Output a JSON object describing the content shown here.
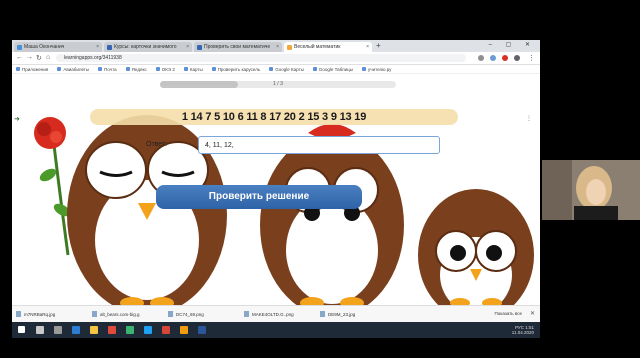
{
  "browser": {
    "tabs": [
      {
        "label": "Маша Окончанич",
        "color": "#4a90d9"
      },
      {
        "label": "Курсы: карточки значимого",
        "color": "#3466b4"
      },
      {
        "label": "Проверить свои математиче",
        "color": "#3466b4"
      },
      {
        "label": "Веселый математик",
        "color": "#f2a93b",
        "active": true
      }
    ],
    "new_tab": "+",
    "window_controls": "– ▢ ✕",
    "url": "learningapps.org/3411938",
    "bookmarks": [
      "Приложения",
      "Авиабилеты",
      "Почта",
      "Яндекс",
      "ОКЭ 2",
      "Карты",
      "Проверить карусель",
      "Google Карты",
      "Google Таблицы",
      "учителю.ру"
    ]
  },
  "task": {
    "progress_text": "1 / 3",
    "progress_fraction": 0.33,
    "numbers": "1 14 7 5 10 6 11 8 17 20 2 15 3 9 13 19",
    "answer_label": "Ответ:",
    "answer_value": "4, 11, 12,",
    "check_button": "Проверить решение"
  },
  "downloads": {
    "items": [
      "m7NRBaRq.jpg",
      "alt_bears.com-big.g",
      "DC74_69.png",
      "MAKE4OLTD.G..png",
      "DE9M_23.jpg"
    ],
    "show_all": "Показать все",
    "close": "✕"
  },
  "taskbar": {
    "time": "1:51",
    "date": "11.04.2020",
    "lang": "РУС"
  },
  "colors": {
    "button": "#3a72b8",
    "numbers_bg": "#f4deaa",
    "owl_brown": "#7a3f1d"
  }
}
